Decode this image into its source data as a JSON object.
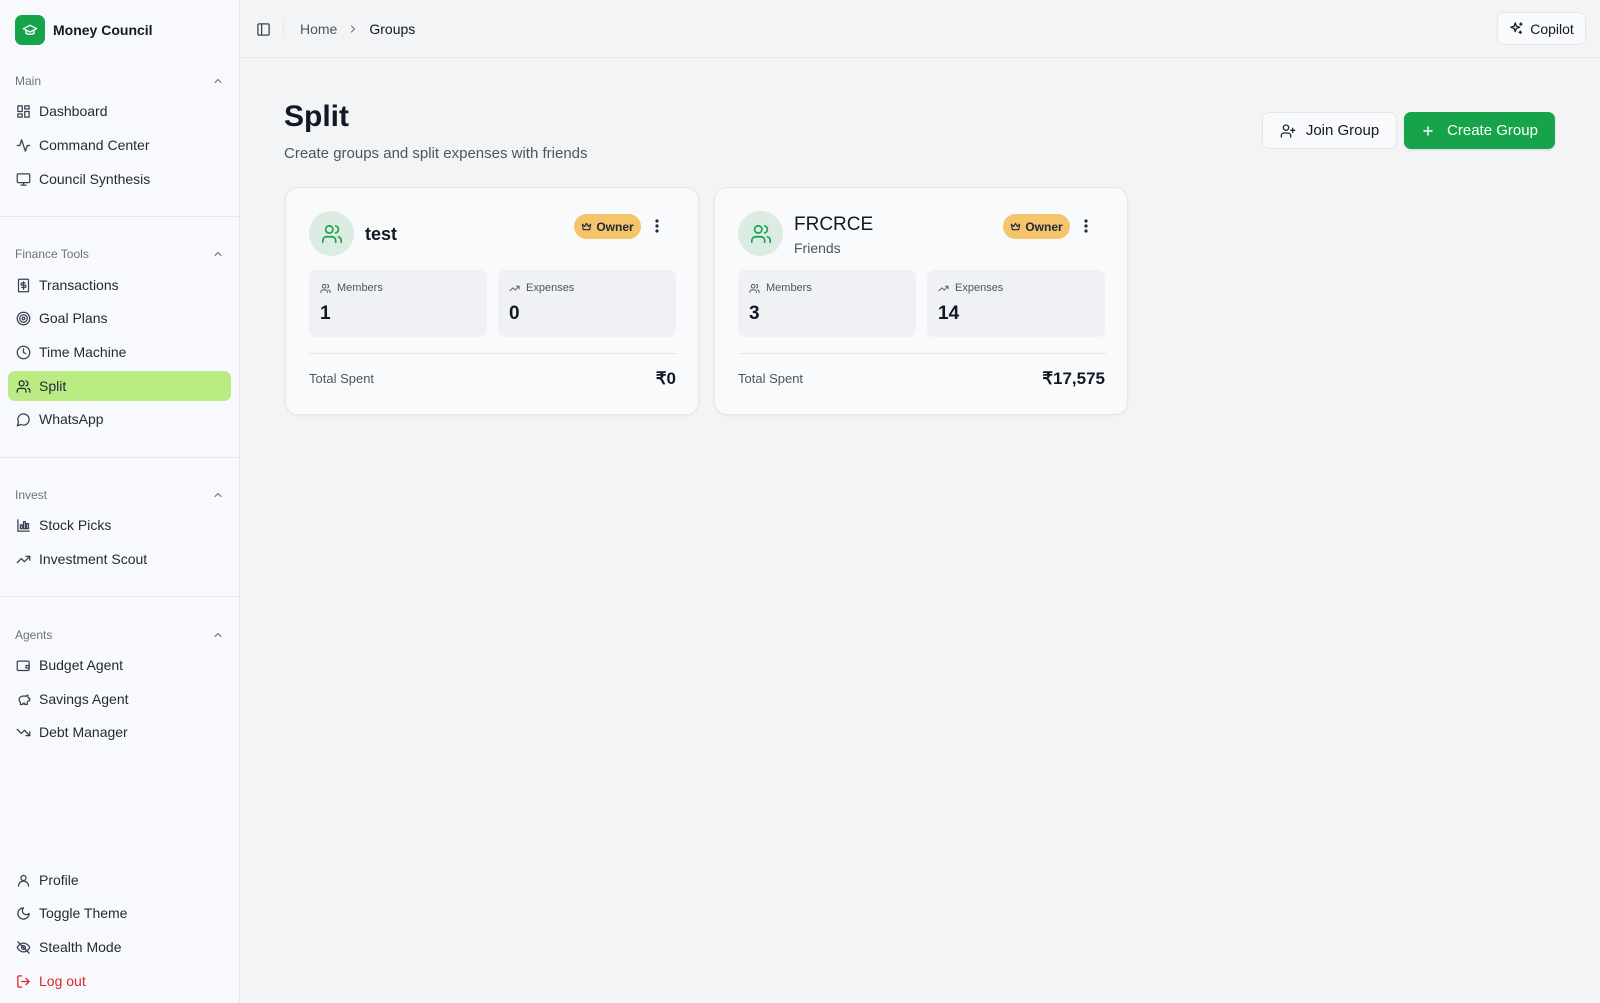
{
  "app": {
    "name": "Money Council",
    "logo_icon": "graduation-cap-icon"
  },
  "sidebar": {
    "sections": [
      {
        "title": "Main",
        "items": [
          {
            "label": "Dashboard",
            "icon": "dashboard-icon"
          },
          {
            "label": "Command Center",
            "icon": "activity-icon"
          },
          {
            "label": "Council Synthesis",
            "icon": "monitor-icon"
          }
        ]
      },
      {
        "title": "Finance Tools",
        "items": [
          {
            "label": "Transactions",
            "icon": "receipt-icon"
          },
          {
            "label": "Goal Plans",
            "icon": "target-icon"
          },
          {
            "label": "Time Machine",
            "icon": "clock-icon"
          },
          {
            "label": "Split",
            "icon": "users-icon",
            "active": true
          },
          {
            "label": "WhatsApp",
            "icon": "message-circle-icon"
          }
        ]
      },
      {
        "title": "Invest",
        "items": [
          {
            "label": "Stock Picks",
            "icon": "bar-chart-icon"
          },
          {
            "label": "Investment Scout",
            "icon": "trending-up-icon"
          }
        ]
      },
      {
        "title": "Agents",
        "items": [
          {
            "label": "Budget Agent",
            "icon": "wallet-icon"
          },
          {
            "label": "Savings Agent",
            "icon": "piggy-bank-icon"
          },
          {
            "label": "Debt Manager",
            "icon": "trending-down-icon"
          }
        ]
      }
    ],
    "footer": [
      {
        "label": "Profile",
        "icon": "user-icon"
      },
      {
        "label": "Toggle Theme",
        "icon": "moon-icon"
      },
      {
        "label": "Stealth Mode",
        "icon": "eye-off-icon"
      },
      {
        "label": "Log out",
        "icon": "log-out-icon"
      }
    ]
  },
  "topbar": {
    "breadcrumb": {
      "home": "Home",
      "current": "Groups"
    },
    "copilot_label": "Copilot"
  },
  "main": {
    "title": "Split",
    "subtitle": "Create groups and split expenses with friends",
    "join_label": "Join Group",
    "create_label": "Create Group"
  },
  "groups": [
    {
      "name": "test",
      "category": "",
      "badge": "Owner",
      "members_label": "Members",
      "members": "1",
      "expenses_label": "Expenses",
      "expenses": "0",
      "total_label": "Total Spent",
      "total": "₹0"
    },
    {
      "name": "FRCRCE",
      "category": "Friends",
      "badge": "Owner",
      "members_label": "Members",
      "members": "3",
      "expenses_label": "Expenses",
      "expenses": "14",
      "total_label": "Total Spent",
      "total": "₹17,575"
    }
  ],
  "colors": {
    "accent": "#16a34a",
    "active_nav": "#bbeb83",
    "owner_badge": "#f5c46b",
    "danger": "#dc2626"
  }
}
